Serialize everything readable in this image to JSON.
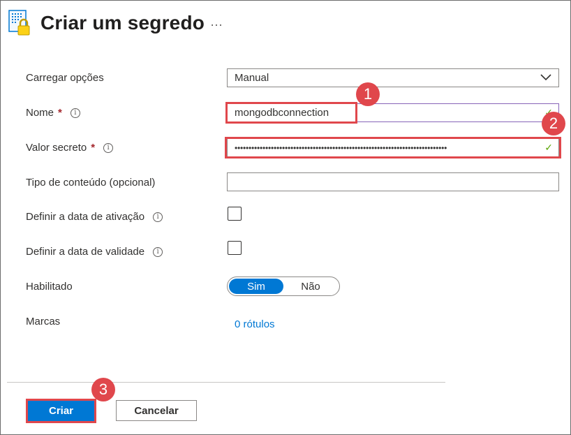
{
  "header": {
    "title": "Criar um segredo",
    "more": "···",
    "icon": "key-vault-secret-icon"
  },
  "form": {
    "upload": {
      "label": "Carregar opções",
      "value": "Manual"
    },
    "name": {
      "label": "Nome",
      "required": "*",
      "value": "mongodbconnection"
    },
    "secret": {
      "label": "Valor secreto",
      "required": "*",
      "value": "••••••••••••••••••••••••••••••••••••••••••••••••••••••••••••••••••••••••••••"
    },
    "content_type": {
      "label": "Tipo de conteúdo (opcional)",
      "value": ""
    },
    "activation": {
      "label": "Definir a data de ativação"
    },
    "expiration": {
      "label": "Definir a data de validade"
    },
    "enabled": {
      "label": "Habilitado",
      "on": "Sim",
      "off": "Não"
    },
    "tags": {
      "label": "Marcas",
      "link": "0 rótulos"
    }
  },
  "info_glyph": "i",
  "check_glyph": "✓",
  "footer": {
    "create": "Criar",
    "cancel": "Cancelar"
  },
  "annotations": [
    "1",
    "2",
    "3"
  ],
  "colors": {
    "accent": "#0078d4",
    "highlight": "#e0474c",
    "success": "#57a300",
    "name_border": "#8764b8"
  }
}
